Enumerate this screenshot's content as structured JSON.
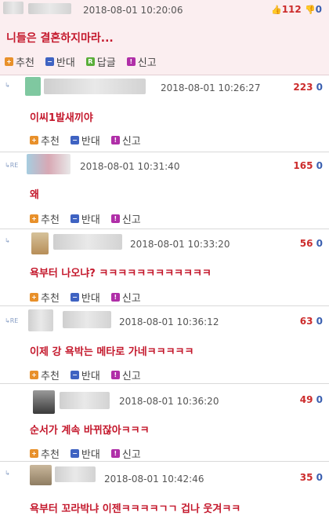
{
  "post": {
    "date": "2018-08-01 10:20:06",
    "up_count": "112",
    "down_count": "0",
    "title": "니들은 결혼하지마라...",
    "actions": {
      "recommend": "추천",
      "oppose": "반대",
      "reply": "답글",
      "report": "신고"
    }
  },
  "comment_actions": {
    "recommend": "추천",
    "oppose": "반대",
    "report": "신고"
  },
  "re_label": "RE",
  "comments": [
    {
      "date": "2018-08-01 10:26:27",
      "up": "223",
      "down": "0",
      "text": "이씨1발새끼야"
    },
    {
      "date": "2018-08-01 10:31:40",
      "up": "165",
      "down": "0",
      "text": "왜"
    },
    {
      "date": "2018-08-01 10:33:20",
      "up": "56",
      "down": "0",
      "text": "욕부터 나오냐? ㅋㅋㅋㅋㅋㅋㅋㅋㅋㅋㅋㅋ"
    },
    {
      "date": "2018-08-01 10:36:12",
      "up": "63",
      "down": "0",
      "text": "이제 강 욕박는 메타로 가네ㅋㅋㅋㅋㅋ"
    },
    {
      "date": "2018-08-01 10:36:20",
      "up": "49",
      "down": "0",
      "text": "순서가 계속 바뀌잖아ㅋㅋㅋ"
    },
    {
      "date": "2018-08-01 10:42:46",
      "up": "35",
      "down": "0",
      "text": "욕부터 꼬라박냐 이젠ㅋㅋㅋㅋㄱㄱ 겁나 웃겨ㅋㅋ"
    }
  ],
  "colors": {
    "header_bg": "#fbeef0",
    "title_red": "#c4182c",
    "up_red": "#cc2b2b",
    "down_blue": "#3a5fb0"
  }
}
